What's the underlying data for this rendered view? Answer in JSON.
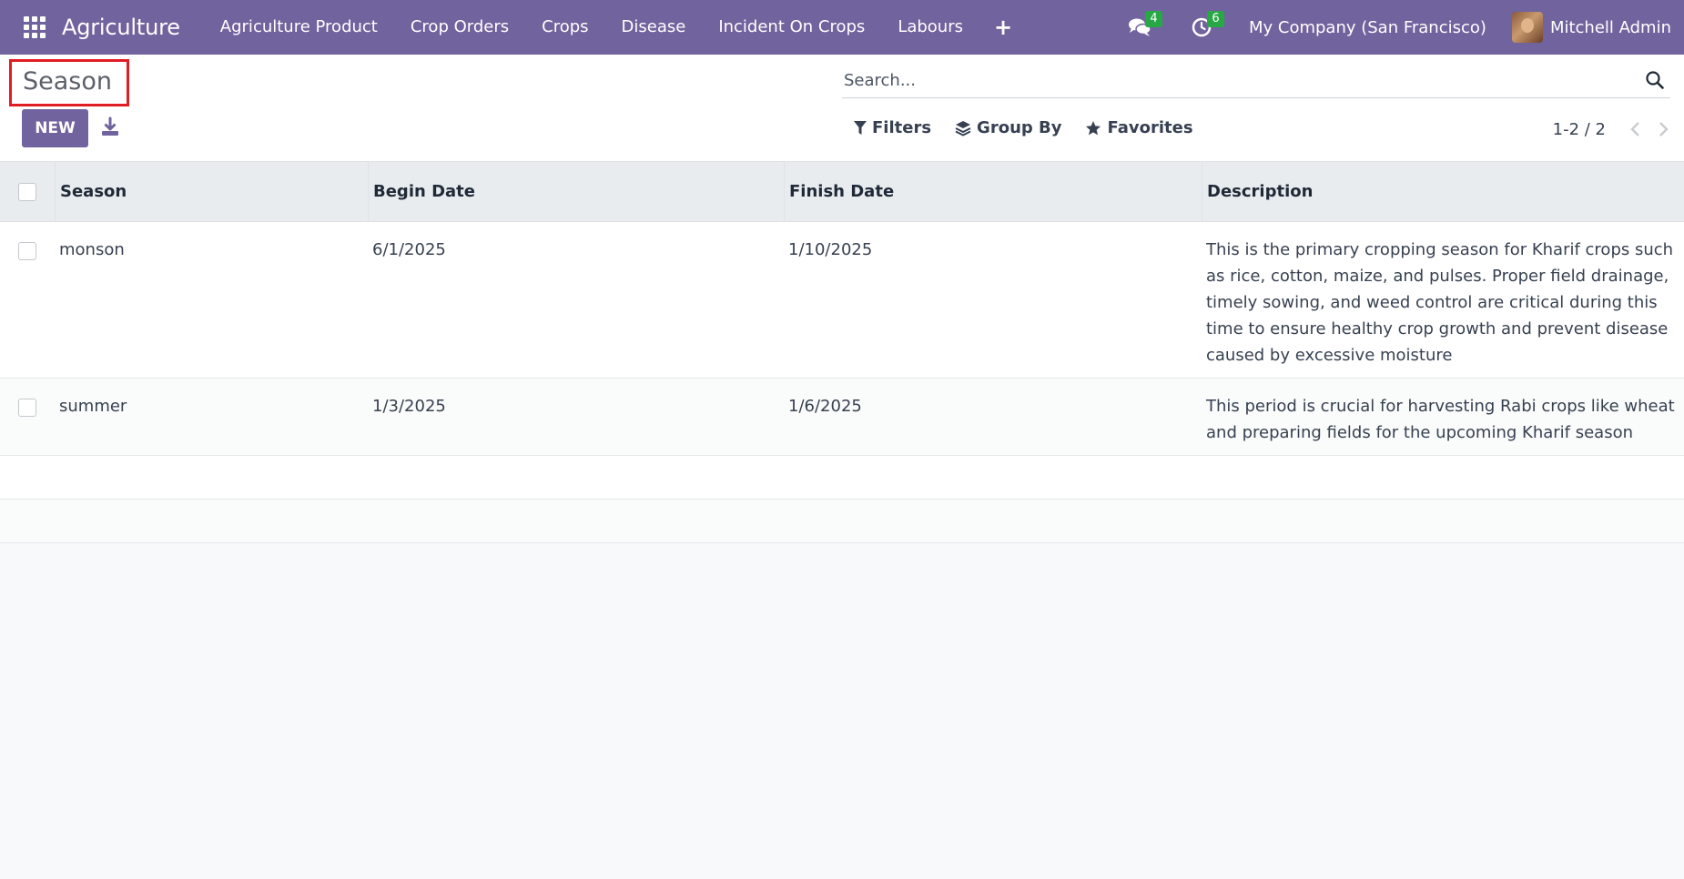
{
  "navbar": {
    "brand": "Agriculture",
    "menu": [
      {
        "label": "Agriculture Product"
      },
      {
        "label": "Crop Orders"
      },
      {
        "label": "Crops"
      },
      {
        "label": "Disease"
      },
      {
        "label": "Incident On Crops"
      },
      {
        "label": "Labours"
      }
    ],
    "plus_icon": "+",
    "messages_badge": "4",
    "activities_badge": "6",
    "company": "My Company (San Francisco)",
    "user_name": "Mitchell Admin"
  },
  "control_panel": {
    "title": "Season",
    "new_label": "NEW",
    "search_placeholder": "Search...",
    "filters_label": "Filters",
    "group_by_label": "Group By",
    "favorites_label": "Favorites",
    "pager_value": "1-2 / 2"
  },
  "table": {
    "columns": [
      "Season",
      "Begin Date",
      "Finish Date",
      "Description"
    ],
    "rows": [
      {
        "season": "monson",
        "begin_date": "6/1/2025",
        "finish_date": "1/10/2025",
        "description": "This is the primary cropping season for Kharif crops such as rice, cotton, maize, and pulses. Proper field drainage, timely sowing, and weed control are critical during this time to ensure healthy crop growth and prevent disease caused by excessive moisture"
      },
      {
        "season": "summer",
        "begin_date": "1/3/2025",
        "finish_date": "1/6/2025",
        "description": "This period is crucial for harvesting Rabi crops like wheat and preparing fields for the upcoming Kharif season"
      }
    ]
  },
  "colors": {
    "navbar": "#71639e",
    "primary_button": "#71639e",
    "badge": "#28a745",
    "highlight_border": "#e11d24"
  },
  "icons": [
    "apps-grid-icon",
    "chat-icon",
    "clock-icon",
    "download-icon",
    "search-icon",
    "filter-icon",
    "layers-icon",
    "star-icon",
    "chevron-left-icon",
    "chevron-right-icon"
  ]
}
